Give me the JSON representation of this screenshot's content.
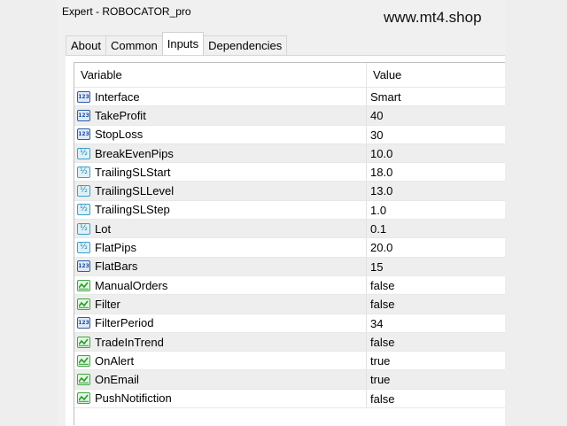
{
  "window": {
    "title": "Expert - ROBOCATOR_pro",
    "watermark": "www.mt4.shop"
  },
  "tabs": [
    {
      "label": "About",
      "active": false
    },
    {
      "label": "Common",
      "active": false
    },
    {
      "label": "Inputs",
      "active": true
    },
    {
      "label": "Dependencies",
      "active": false
    }
  ],
  "table": {
    "headers": [
      "Variable",
      "Value"
    ],
    "rows": [
      {
        "icon": "int-type-icon",
        "variable": "Interface",
        "value": "Smart"
      },
      {
        "icon": "int-type-icon",
        "variable": "TakeProfit",
        "value": "40"
      },
      {
        "icon": "int-type-icon",
        "variable": "StopLoss",
        "value": "30"
      },
      {
        "icon": "double-type-icon",
        "variable": "BreakEvenPips",
        "value": "10.0"
      },
      {
        "icon": "double-type-icon",
        "variable": "TrailingSLStart",
        "value": "18.0"
      },
      {
        "icon": "double-type-icon",
        "variable": "TrailingSLLevel",
        "value": "13.0"
      },
      {
        "icon": "double-type-icon",
        "variable": "TrailingSLStep",
        "value": "1.0"
      },
      {
        "icon": "double-type-icon",
        "variable": "Lot",
        "value": "0.1"
      },
      {
        "icon": "double-type-icon",
        "variable": "FlatPips",
        "value": "20.0"
      },
      {
        "icon": "int-type-icon",
        "variable": "FlatBars",
        "value": "15"
      },
      {
        "icon": "bool-type-icon",
        "variable": "ManualOrders",
        "value": "false"
      },
      {
        "icon": "bool-type-icon",
        "variable": "Filter",
        "value": "false"
      },
      {
        "icon": "int-type-icon",
        "variable": "FilterPeriod",
        "value": "34"
      },
      {
        "icon": "bool-type-icon",
        "variable": "TradeInTrend",
        "value": "false"
      },
      {
        "icon": "bool-type-icon",
        "variable": "OnAlert",
        "value": "true"
      },
      {
        "icon": "bool-type-icon",
        "variable": "OnEmail",
        "value": "true"
      },
      {
        "icon": "bool-type-icon",
        "variable": "PushNotifiction",
        "value": "false"
      }
    ]
  }
}
